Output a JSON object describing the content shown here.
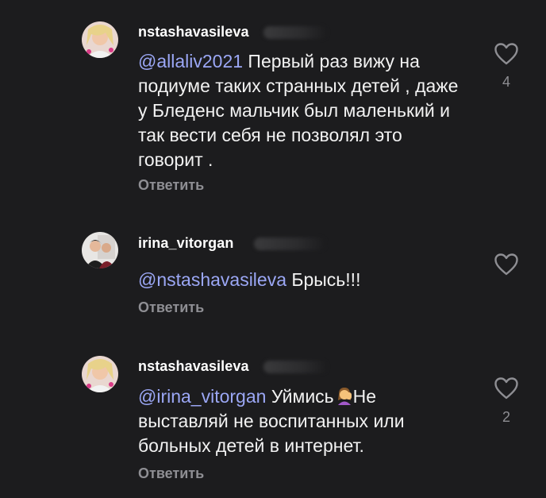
{
  "comments": [
    {
      "username": "nstashavasileva",
      "mention": "@allaliv2021",
      "text": " Первый раз вижу на подиуме таких странных детей , даже у Бледенс мальчик был маленький и так вести себя не позволял это говорит .",
      "reply_label": "Ответить",
      "likes": "4"
    },
    {
      "username": "irina_vitorgan",
      "mention": "@nstashavasileva",
      "text": " Брысь!!!",
      "reply_label": "Ответить",
      "likes": ""
    },
    {
      "username": "nstashavasileva",
      "mention": "@irina_vitorgan",
      "text": " Уймись",
      "text_after_emoji": "Не выставляй не воспитанных или больных детей в интернет.",
      "emoji": "woman-facepalming-emoji",
      "reply_label": "Ответить",
      "likes": "2"
    }
  ],
  "icons": {
    "like": "heart-outline-icon"
  },
  "colors": {
    "background": "#1c1c1e",
    "mention": "#9ba7f5",
    "secondary": "#8e8e93"
  }
}
